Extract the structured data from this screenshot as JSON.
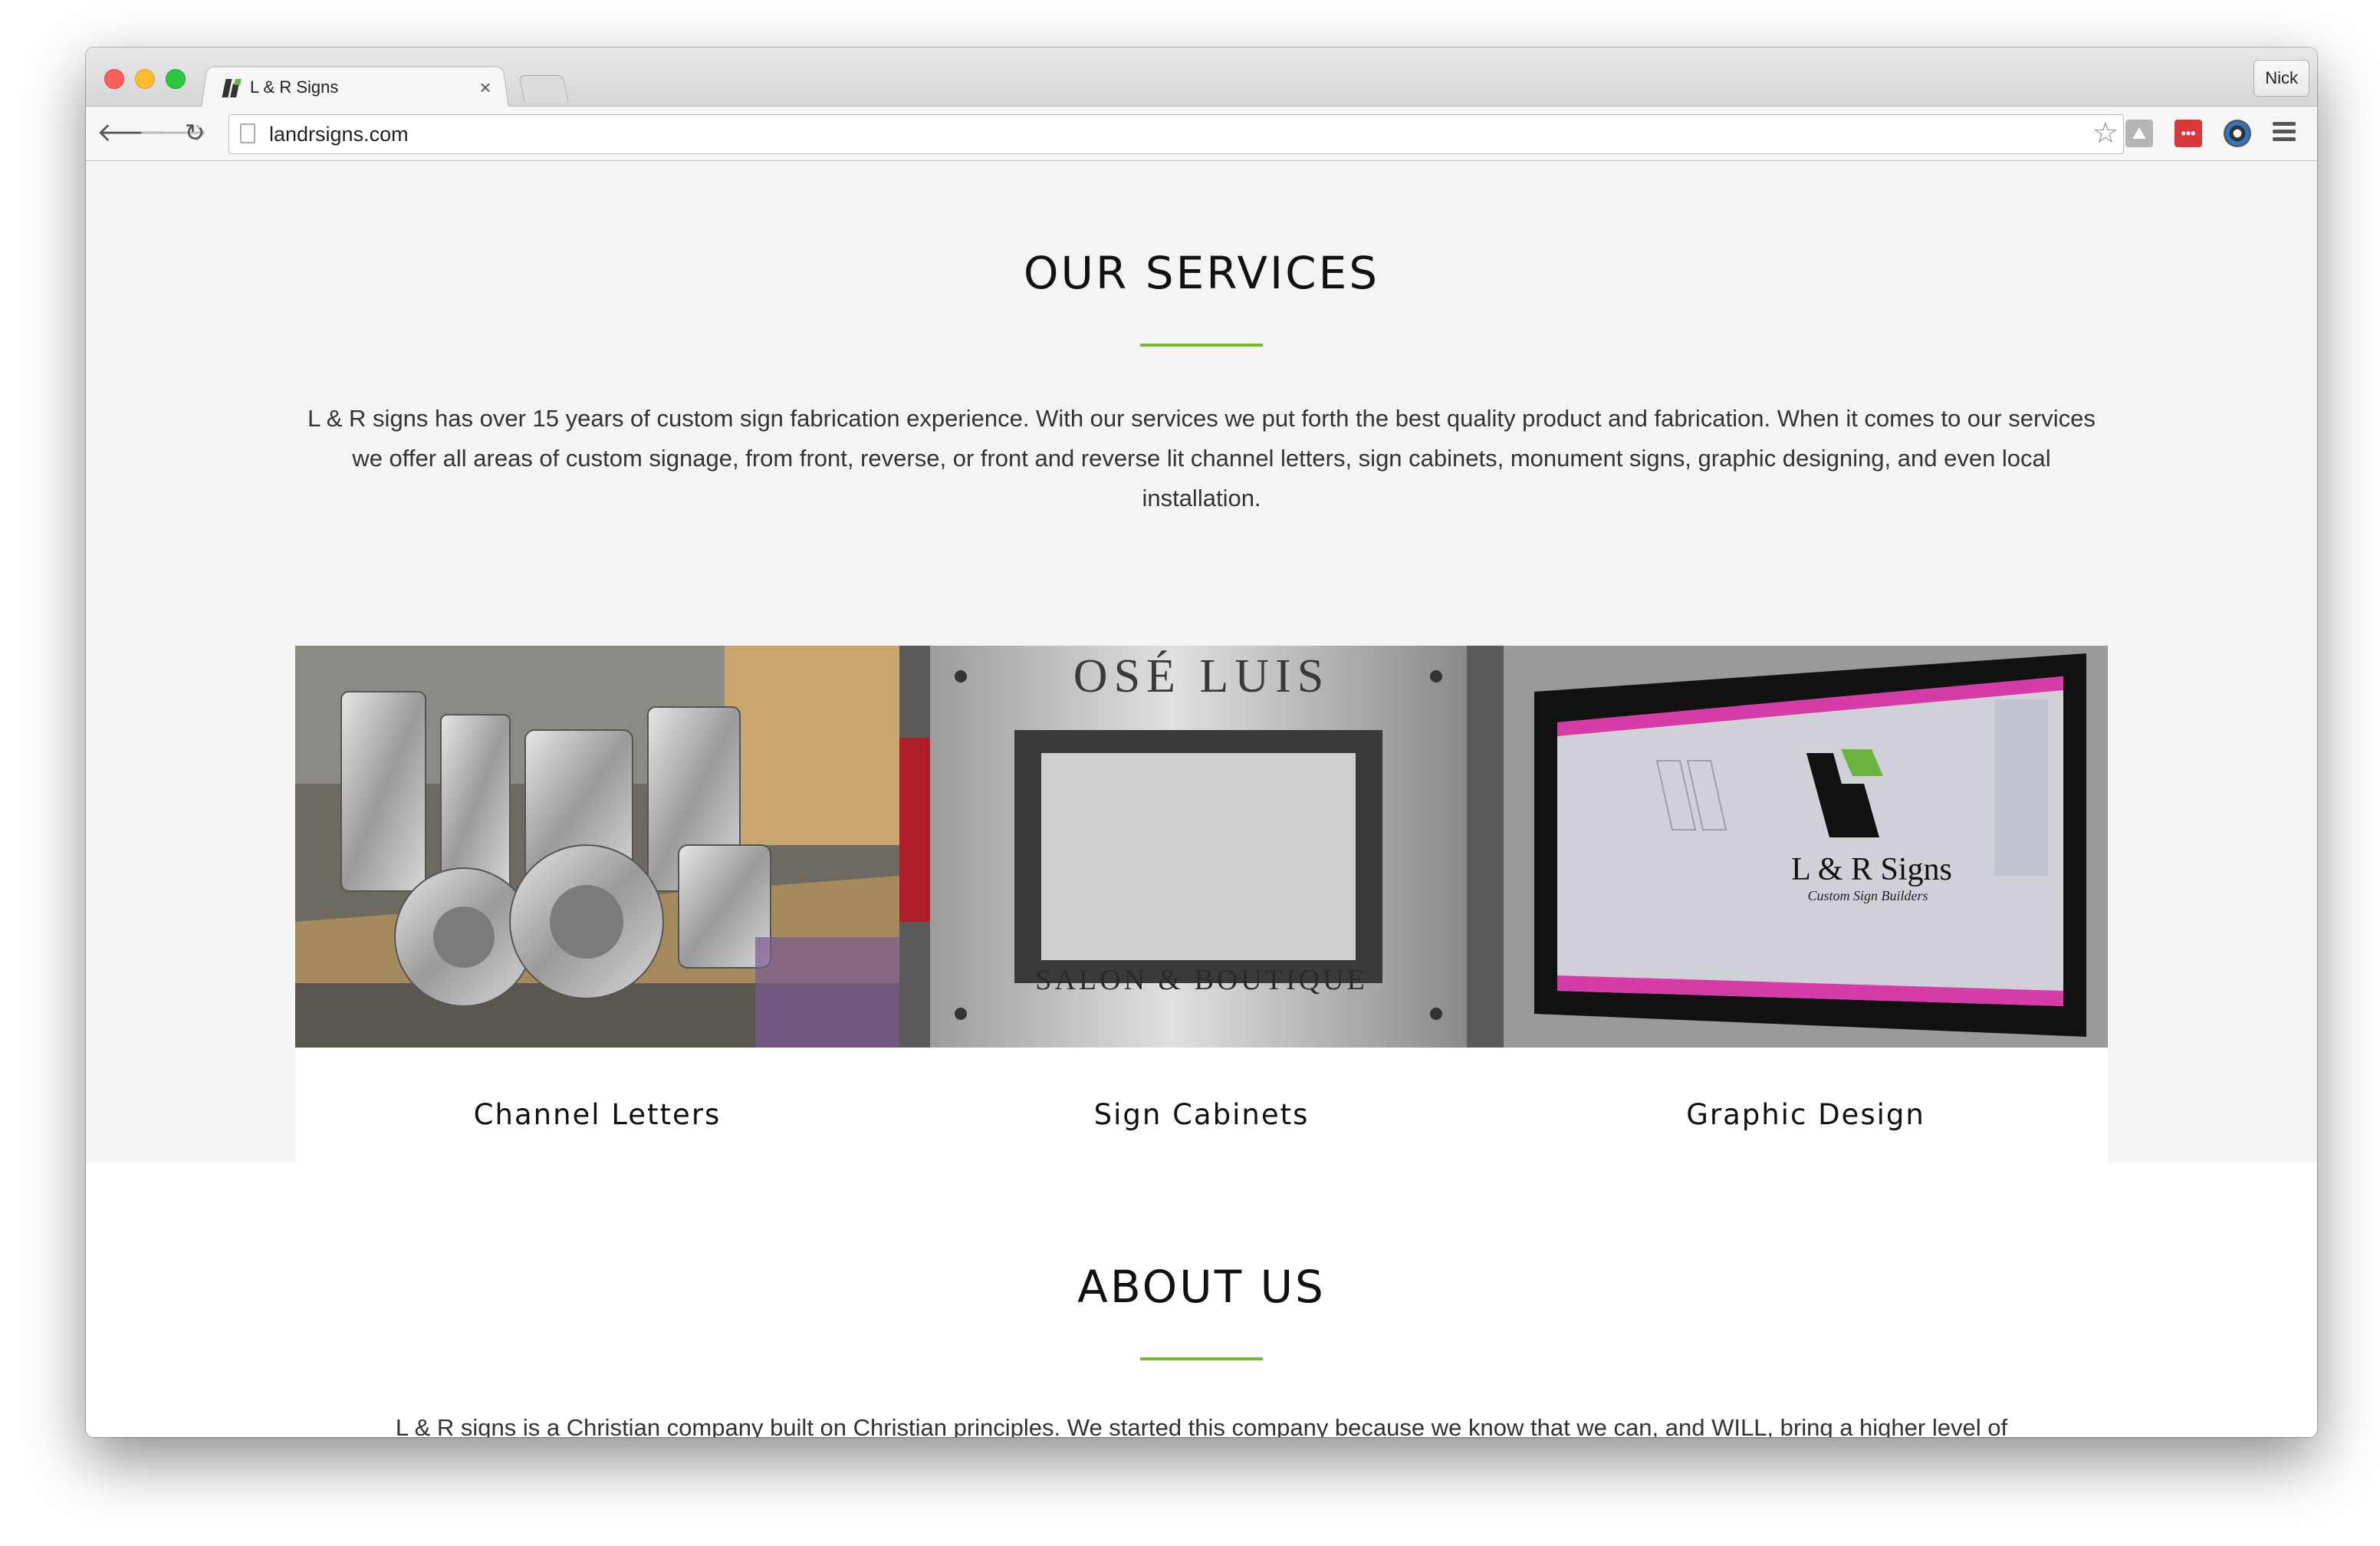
{
  "browser": {
    "tab_title": "L & R Signs",
    "tab_close": "×",
    "url": "landrsigns.com",
    "profile_name": "Nick",
    "extensions": [
      "hike-icon",
      "readmore-icon",
      "camera-lens-icon"
    ]
  },
  "services": {
    "title": "OUR SERVICES",
    "intro": "L & R signs has over 15 years of custom sign fabrication experience. With our services we put forth the best quality product and fabrication. When it comes to our services we offer all areas of custom signage, from front, reverse, or front and reverse lit channel letters, sign cabinets, monument signs, graphic designing, and even local installation.",
    "cards": [
      {
        "label": "Channel Letters"
      },
      {
        "label": "Sign Cabinets",
        "photo_text_top": "OSÉ LUIS",
        "photo_text_bottom": "SALON & BOUTIQUE"
      },
      {
        "label": "Graphic Design",
        "screen_logo_text": "L & R Signs",
        "screen_logo_tagline": "Custom Sign Builders"
      }
    ]
  },
  "about": {
    "title": "ABOUT US",
    "text": "L & R signs is a Christian company built on Christian principles. We started this company because we know that we can, and WILL, bring a higher level of"
  },
  "colors": {
    "accent": "#79b829",
    "section_bg": "#f4f4f4",
    "card_bg": "#ffffff"
  }
}
